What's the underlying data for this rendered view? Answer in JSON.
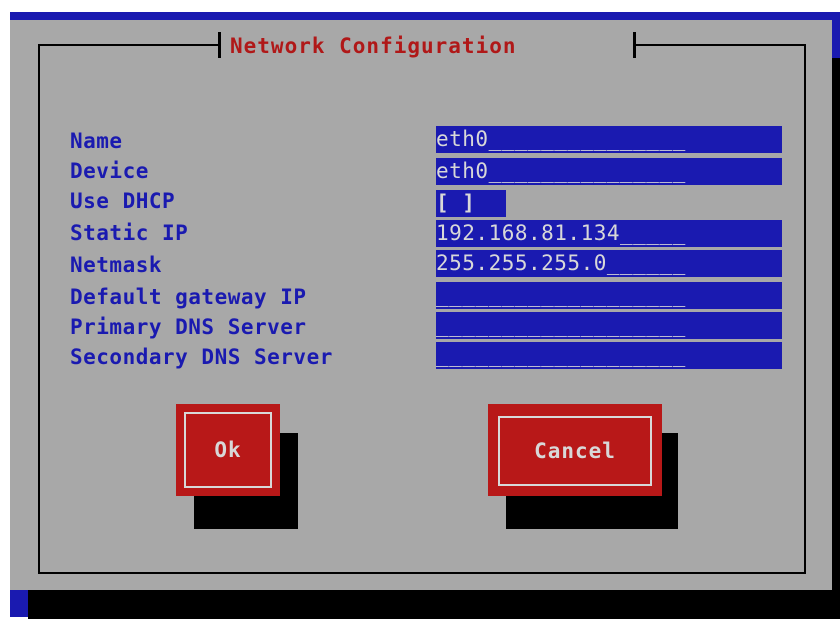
{
  "dialog": {
    "title": "Network Configuration"
  },
  "form": {
    "fields": [
      {
        "label": "Name",
        "value": "eth0_______________"
      },
      {
        "label": "Device",
        "value": "eth0_______________"
      },
      {
        "label": "Use DHCP",
        "value": "[ ]"
      },
      {
        "label": "Static IP",
        "value": "192.168.81.134_____"
      },
      {
        "label": "Netmask",
        "value": "255.255.255.0______"
      },
      {
        "label": "Default gateway IP",
        "value": "___________________"
      },
      {
        "label": "Primary DNS Server",
        "value": "___________________"
      },
      {
        "label": "Secondary DNS Server",
        "value": "___________________"
      }
    ]
  },
  "buttons": {
    "ok_label": "Ok",
    "cancel_label": "Cancel"
  },
  "colors": {
    "background_blue": "#1a1ab0",
    "dialog_gray": "#a8a8a8",
    "title_red": "#b01818",
    "label_blue": "#1a1ab0",
    "button_red": "#b81818",
    "field_text": "#d8d8d8"
  }
}
